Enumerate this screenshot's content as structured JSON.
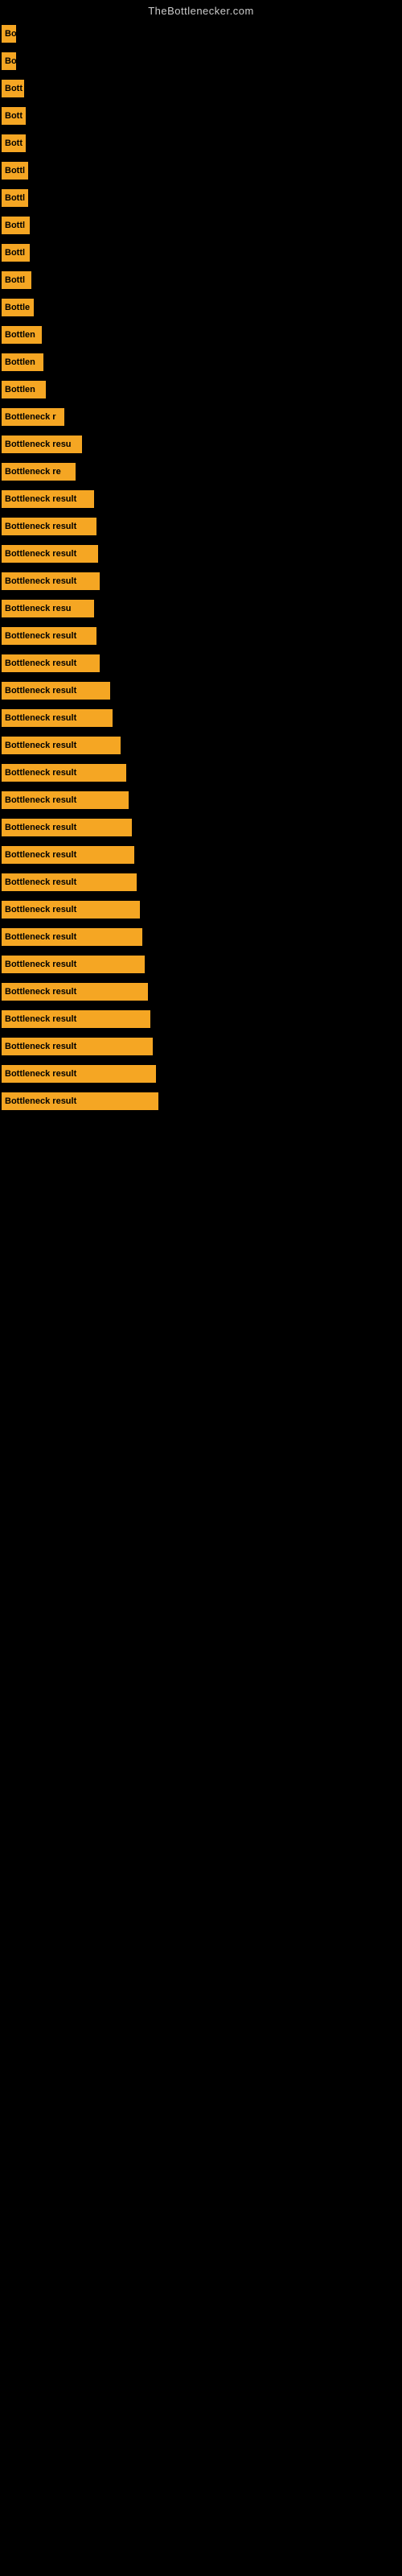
{
  "site_title": "TheBottlenecker.com",
  "bars": [
    {
      "label": "Bo",
      "width": 18
    },
    {
      "label": "Bo",
      "width": 18
    },
    {
      "label": "Bott",
      "width": 28
    },
    {
      "label": "Bott",
      "width": 30
    },
    {
      "label": "Bott",
      "width": 30
    },
    {
      "label": "Bottl",
      "width": 33
    },
    {
      "label": "Bottl",
      "width": 33
    },
    {
      "label": "Bottl",
      "width": 35
    },
    {
      "label": "Bottl",
      "width": 35
    },
    {
      "label": "Bottl",
      "width": 37
    },
    {
      "label": "Bottle",
      "width": 40
    },
    {
      "label": "Bottlen",
      "width": 50
    },
    {
      "label": "Bottlen",
      "width": 52
    },
    {
      "label": "Bottlen",
      "width": 55
    },
    {
      "label": "Bottleneck r",
      "width": 78
    },
    {
      "label": "Bottleneck resu",
      "width": 100
    },
    {
      "label": "Bottleneck re",
      "width": 92
    },
    {
      "label": "Bottleneck result",
      "width": 115
    },
    {
      "label": "Bottleneck result",
      "width": 118
    },
    {
      "label": "Bottleneck result",
      "width": 120
    },
    {
      "label": "Bottleneck result",
      "width": 122
    },
    {
      "label": "Bottleneck resu",
      "width": 115
    },
    {
      "label": "Bottleneck result",
      "width": 118
    },
    {
      "label": "Bottleneck result",
      "width": 122
    },
    {
      "label": "Bottleneck result",
      "width": 135
    },
    {
      "label": "Bottleneck result",
      "width": 138
    },
    {
      "label": "Bottleneck result",
      "width": 148
    },
    {
      "label": "Bottleneck result",
      "width": 155
    },
    {
      "label": "Bottleneck result",
      "width": 158
    },
    {
      "label": "Bottleneck result",
      "width": 162
    },
    {
      "label": "Bottleneck result",
      "width": 165
    },
    {
      "label": "Bottleneck result",
      "width": 168
    },
    {
      "label": "Bottleneck result",
      "width": 172
    },
    {
      "label": "Bottleneck result",
      "width": 175
    },
    {
      "label": "Bottleneck result",
      "width": 178
    },
    {
      "label": "Bottleneck result",
      "width": 182
    },
    {
      "label": "Bottleneck result",
      "width": 185
    },
    {
      "label": "Bottleneck result",
      "width": 188
    },
    {
      "label": "Bottleneck result",
      "width": 192
    },
    {
      "label": "Bottleneck result",
      "width": 195
    }
  ]
}
